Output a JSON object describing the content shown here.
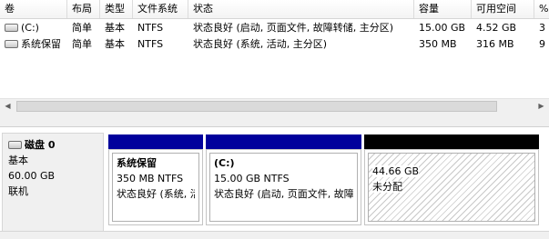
{
  "columns": [
    "卷",
    "布局",
    "类型",
    "文件系统",
    "状态",
    "容量",
    "可用空间",
    "%"
  ],
  "volumes": [
    {
      "name": "(C:)",
      "layout": "简单",
      "type": "基本",
      "fs": "NTFS",
      "status": "状态良好 (启动, 页面文件, 故障转储, 主分区)",
      "capacity": "15.00 GB",
      "free": "4.52 GB",
      "pct": "3"
    },
    {
      "name": "系统保留",
      "layout": "简单",
      "type": "基本",
      "fs": "NTFS",
      "status": "状态良好 (系统, 活动, 主分区)",
      "capacity": "350 MB",
      "free": "316 MB",
      "pct": "9"
    }
  ],
  "scrollbar": {
    "left_arrow": "◀",
    "right_arrow": "▶"
  },
  "disk": {
    "title": "磁盘 0",
    "type": "基本",
    "size": "60.00 GB",
    "state": "联机"
  },
  "partitions": [
    {
      "name": "系统保留",
      "size": "350 MB NTFS",
      "status": "状态良好 (系统, 活动, 主分区)",
      "bar_color": "#00009c"
    },
    {
      "name": "(C:)",
      "size": "15.00 GB NTFS",
      "status": "状态良好 (启动, 页面文件, 故障转储, 主分区)",
      "bar_color": "#00009c"
    }
  ],
  "unallocated": {
    "size": "44.66 GB",
    "label": "未分配",
    "bar_color": "#000000"
  }
}
